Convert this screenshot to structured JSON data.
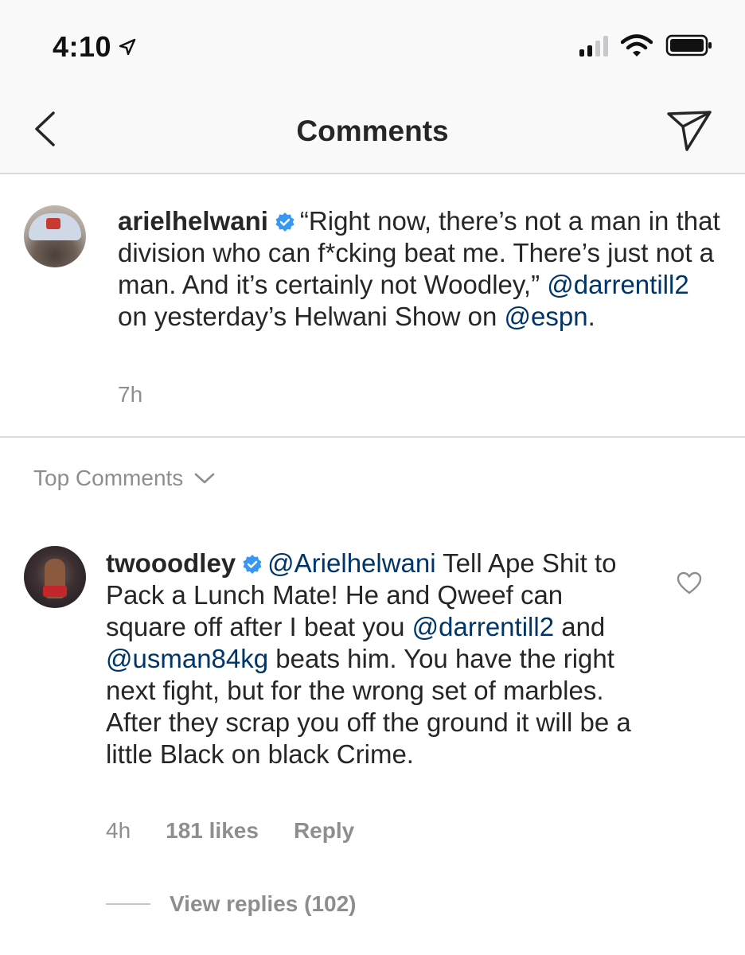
{
  "status_bar": {
    "time": "4:10"
  },
  "nav": {
    "title": "Comments"
  },
  "caption": {
    "username": "arielhelwani",
    "text_1": "“Right now, there’s not a man in that division who can f*cking beat me. There’s just not a man. And it’s certainly not Woodley,” ",
    "mention_1": "@darrentill2",
    "text_2": " on yesterday’s Helwani Show on ",
    "mention_2": "@espn",
    "text_3": ".",
    "time": "7h"
  },
  "section": {
    "top_comments_label": "Top Comments"
  },
  "comment": {
    "username": "twooodley",
    "mention_1": "@Arielhelwani",
    "text_1": " Tell Ape Shit to Pack a Lunch Mate! He and Qweef can square off after I beat you ",
    "mention_2": "@darrentill2",
    "text_2": " and ",
    "mention_3": "@usman84kg",
    "text_3": " beats him. You have the right next fight, but for the wrong set of marbles. After they scrap you off the ground it will be a little Black on black Crime.",
    "time": "4h",
    "likes": "181 likes",
    "reply_label": "Reply",
    "view_replies": "View replies (102)"
  },
  "colors": {
    "mention": "#003569",
    "verified": "#3897f0",
    "muted": "#8e8e8e"
  }
}
